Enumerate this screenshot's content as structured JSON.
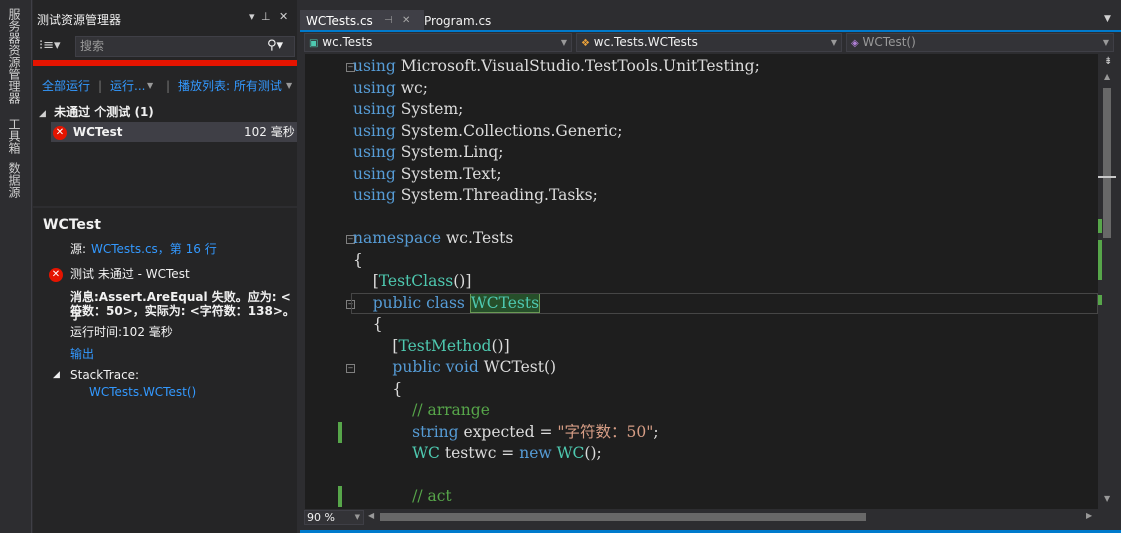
{
  "side_tabs": [
    "服务器资源管理器",
    "工具箱",
    "数据源"
  ],
  "explorer": {
    "title": "测试资源管理器",
    "search_placeholder": "搜索",
    "commands": {
      "run_all": "全部运行",
      "run": "运行...",
      "playlist": "播放列表: 所有测试"
    },
    "group_label": "未通过 个测试 (1)",
    "test_row": {
      "name": "WCTest",
      "duration": "102 毫秒"
    },
    "detail": {
      "title": "WCTest",
      "source_label": "源:",
      "source_link": "WCTests.cs，第 16 行",
      "status_text": "测试 未通过 - WCTest",
      "message_line1": "消息:Assert.AreEqual 失败。应为: <字",
      "message_line2": "符数：50>，实际为: <字符数：138>。",
      "elapsed": "运行时间:102 毫秒",
      "output_link": "输出",
      "stacktrace_label": "StackTrace:",
      "stacktrace_link": "WCTests.WCTest()"
    }
  },
  "editor": {
    "tabs": [
      {
        "label": "WCTests.cs",
        "active": true
      },
      {
        "label": "Program.cs",
        "active": false
      }
    ],
    "nav": {
      "project": "wc.Tests",
      "class": "wc.Tests.WCTests",
      "member": "WCTest()"
    },
    "zoom": "90 %",
    "code_lines": [
      "using Microsoft.VisualStudio.TestTools.UnitTesting;",
      "using wc;",
      "using System;",
      "using System.Collections.Generic;",
      "using System.Linq;",
      "using System.Text;",
      "using System.Threading.Tasks;",
      "",
      "namespace wc.Tests",
      "{",
      "    [TestClass()]",
      "    public class WCTests",
      "    {",
      "        [TestMethod()]",
      "        public void WCTest()",
      "        {",
      "            // arrange",
      "            string expected = \"字符数：50\";",
      "            WC testwc = new WC();",
      "",
      "            // act"
    ]
  },
  "colors": {
    "keyword": "#569cd6",
    "type": "#4ec9b0",
    "comment": "#57a64a",
    "string": "#d69d85",
    "error": "#e51400",
    "accent": "#007acc"
  }
}
